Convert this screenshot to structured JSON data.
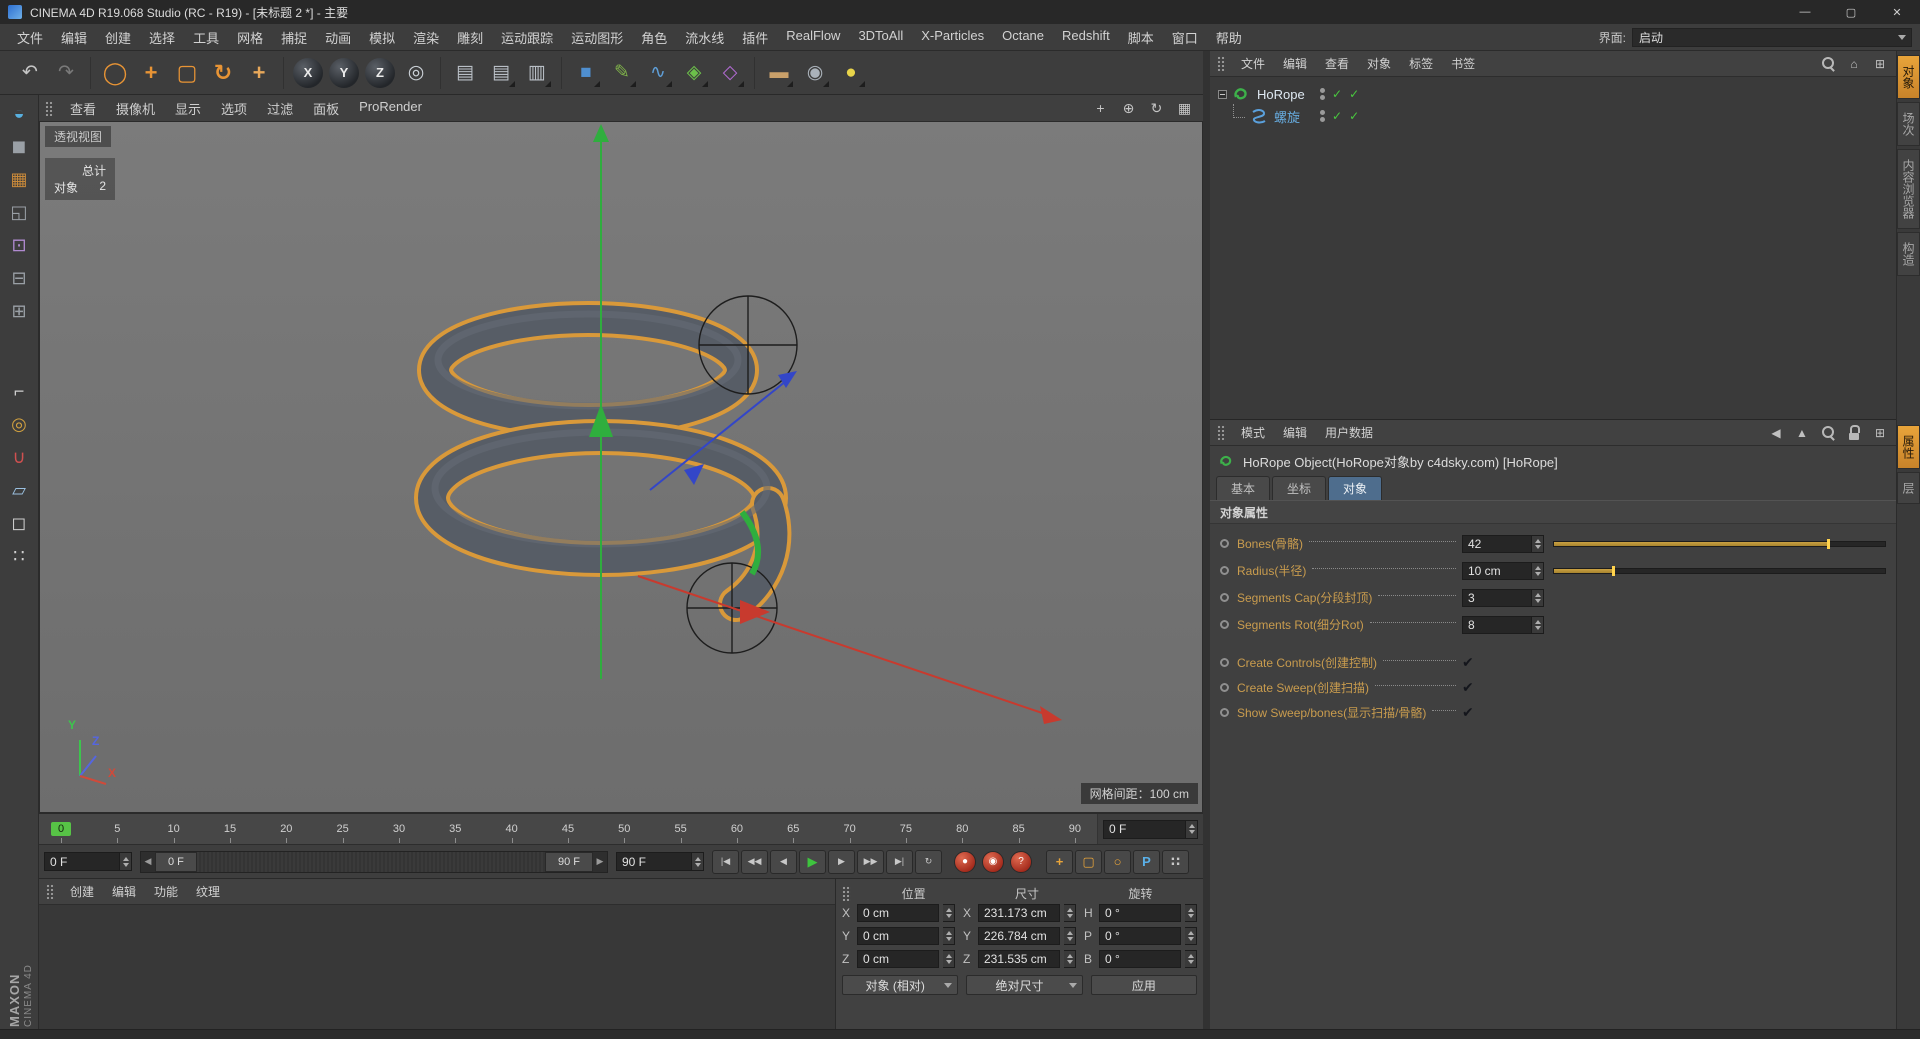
{
  "window": {
    "title": "CINEMA 4D R19.068 Studio (RC - R19) - [未标题 2 *] - 主要",
    "buttons": [
      {
        "name": "minimize-button",
        "glyph": "—"
      },
      {
        "name": "maximize-button",
        "glyph": "▢"
      },
      {
        "name": "close-button",
        "glyph": "✕"
      }
    ]
  },
  "menu_bar": {
    "items": [
      "文件",
      "编辑",
      "创建",
      "选择",
      "工具",
      "网格",
      "捕捉",
      "动画",
      "模拟",
      "渲染",
      "雕刻",
      "运动跟踪",
      "运动图形",
      "角色",
      "流水线",
      "插件",
      "RealFlow",
      "3DToAll",
      "X-Particles",
      "Octane",
      "Redshift",
      "脚本",
      "窗口",
      "帮助"
    ],
    "interface_label": "界面:",
    "interface_value": "启动"
  },
  "toolbar": {
    "history": [
      {
        "name": "undo-icon",
        "glyph": "↶",
        "fg": "#c6c6c6"
      },
      {
        "name": "redo-icon",
        "glyph": "↷",
        "fg": "#7a7a7a"
      }
    ],
    "tools": [
      {
        "name": "live-selection-icon",
        "glyph": "◯",
        "fg": "#e89435",
        "cls": "big"
      },
      {
        "name": "move-tool-icon",
        "glyph": "+",
        "fg": "#e89435",
        "cls": "big"
      },
      {
        "name": "scale-tool-icon",
        "glyph": "▢",
        "fg": "#e89435",
        "cls": "big"
      },
      {
        "name": "rotate-tool-icon",
        "glyph": "↻",
        "fg": "#e89435",
        "cls": "big"
      },
      {
        "name": "last-tool-icon",
        "glyph": "+",
        "fg": "#e8a85a",
        "cls": "big"
      }
    ],
    "axis": [
      {
        "name": "x-axis-lock-icon",
        "glyph": "X",
        "cls": "ball"
      },
      {
        "name": "y-axis-lock-icon",
        "glyph": "Y",
        "cls": "ball"
      },
      {
        "name": "z-axis-lock-icon",
        "glyph": "Z",
        "cls": "ball"
      },
      {
        "name": "coordinate-system-icon",
        "glyph": "◎",
        "fg": "#ccd2d8"
      }
    ],
    "render": [
      {
        "name": "render-view-icon",
        "glyph": "▤",
        "fg": "#b9bfc6"
      },
      {
        "name": "render-picture-viewer-icon",
        "glyph": "▤",
        "fg": "#b9bfc6",
        "cls": "corner"
      },
      {
        "name": "render-settings-icon",
        "glyph": "▥",
        "fg": "#b9bfc6",
        "cls": "corner"
      }
    ],
    "create": [
      {
        "name": "cube-primitive-icon",
        "glyph": "■",
        "fg": "#4f8fd0",
        "cls": "corner"
      },
      {
        "name": "spline-pen-icon",
        "glyph": "✎",
        "fg": "#7fb24a",
        "cls": "corner"
      },
      {
        "name": "spline-primitives-icon",
        "glyph": "∿",
        "fg": "#5f9fd8",
        "cls": "corner"
      },
      {
        "name": "mograph-icon",
        "glyph": "◈",
        "fg": "#6cc04a",
        "cls": "corner"
      },
      {
        "name": "deformer-icon",
        "glyph": "◇",
        "fg": "#b06ad0",
        "cls": "corner"
      }
    ],
    "scene": [
      {
        "name": "environment-floor-icon",
        "glyph": "▬",
        "fg": "#c9a06a",
        "cls": "corner"
      },
      {
        "name": "camera-icon",
        "glyph": "◉",
        "fg": "#aab2ba",
        "cls": "corner"
      },
      {
        "name": "light-icon",
        "glyph": "●",
        "fg": "#e8d44a",
        "cls": "corner"
      }
    ]
  },
  "left_toolbar": {
    "icons": [
      {
        "name": "convert-editable-icon",
        "glyph": "◒",
        "fg": "#58b0e0"
      },
      {
        "name": "model-mode-icon",
        "glyph": "◼",
        "fg": "#9aa0a6"
      },
      {
        "name": "texture-mode-icon",
        "glyph": "▦",
        "fg": "#c8893a"
      },
      {
        "name": "workplane-mode-icon",
        "glyph": "◱",
        "fg": "#9aa0a6"
      },
      {
        "name": "point-mode-icon",
        "glyph": "⊡",
        "fg": "#b08ad0"
      },
      {
        "name": "edge-mode-icon",
        "glyph": "⊟",
        "fg": "#9aa0a6"
      },
      {
        "name": "polygon-mode-icon",
        "glyph": "⊞",
        "fg": "#9aa0a6"
      },
      {
        "name": "enable-axis-icon",
        "glyph": "⌐",
        "fg": "#d0d0d0",
        "cls": "gap"
      },
      {
        "name": "viewport-solo-icon",
        "glyph": "◎",
        "fg": "#d0a040"
      },
      {
        "name": "snap-icon",
        "glyph": "∪",
        "fg": "#d05050"
      },
      {
        "name": "workplane-icon",
        "glyph": "▱",
        "fg": "#9ac0e0"
      },
      {
        "name": "lock-workplane-icon",
        "glyph": "◻",
        "fg": "#d0d0d0"
      },
      {
        "name": "quantize-icon",
        "glyph": "∷",
        "fg": "#d0d0d0"
      }
    ]
  },
  "viewport": {
    "menu_items": [
      "查看",
      "摄像机",
      "显示",
      "选项",
      "过滤",
      "面板",
      "ProRender"
    ],
    "nav_icons": [
      {
        "name": "pan-view-icon",
        "glyph": "+"
      },
      {
        "name": "zoom-view-icon",
        "glyph": "⊕"
      },
      {
        "name": "rotate-view-icon",
        "glyph": "↻"
      },
      {
        "name": "toggle-views-icon",
        "glyph": "▦"
      }
    ],
    "view_label": "透视视图",
    "hud": {
      "total_label": "总计",
      "objects_label": "对象",
      "objects_count": "2"
    },
    "grid_label": "网格间距：100 cm",
    "axis": {
      "x": "X",
      "y": "Y",
      "z": "Z"
    }
  },
  "timeline": {
    "ticks": [
      {
        "t": "0",
        "cls": "cur"
      },
      {
        "t": "5"
      },
      {
        "t": "10"
      },
      {
        "t": "15"
      },
      {
        "t": "20"
      },
      {
        "t": "25"
      },
      {
        "t": "30"
      },
      {
        "t": "35"
      },
      {
        "t": "40"
      },
      {
        "t": "45"
      },
      {
        "t": "50"
      },
      {
        "t": "55"
      },
      {
        "t": "60"
      },
      {
        "t": "65"
      },
      {
        "t": "70"
      },
      {
        "t": "75"
      },
      {
        "t": "80"
      },
      {
        "t": "85"
      },
      {
        "t": "90"
      }
    ],
    "frame_spinner": "0 F"
  },
  "transport": {
    "current_frame": "0 F",
    "range_start": "0 F",
    "range_end": "90 F",
    "range_left_glyph": "◀",
    "range_right_glyph": "▶",
    "end_frame": "90 F",
    "buttons": [
      {
        "name": "goto-start-button",
        "glyph": "|◀"
      },
      {
        "name": "prev-key-button",
        "glyph": "◀◀"
      },
      {
        "name": "prev-frame-button",
        "glyph": "◀"
      },
      {
        "name": "play-button",
        "glyph": "▶",
        "cls": "play"
      },
      {
        "name": "next-frame-button",
        "glyph": "▶"
      },
      {
        "name": "next-key-button",
        "glyph": "▶▶"
      },
      {
        "name": "goto-end-button",
        "glyph": "▶|"
      },
      {
        "name": "loop-button",
        "glyph": "↻"
      }
    ],
    "record_buttons": [
      {
        "name": "record-keyframe-button",
        "glyph": "●"
      },
      {
        "name": "autokey-button",
        "glyph": "◉"
      },
      {
        "name": "record-options-button",
        "glyph": "?"
      }
    ],
    "key_buttons": [
      {
        "name": "position-key-icon",
        "glyph": "+",
        "fg": "#e8a43a"
      },
      {
        "name": "scale-key-icon",
        "glyph": "▢",
        "fg": "#e8a43a"
      },
      {
        "name": "rotation-key-icon",
        "glyph": "○",
        "fg": "#e8a43a"
      },
      {
        "name": "parameter-key-icon",
        "glyph": "P",
        "fg": "#5ab0e8"
      },
      {
        "name": "pla-key-icon",
        "glyph": "∷",
        "fg": "#c8c8c8"
      }
    ],
    "solo_button": {
      "glyph": "▦"
    }
  },
  "coordinates": {
    "position": {
      "title": "位置",
      "rows": [
        {
          "label": "X",
          "value": "0 cm"
        },
        {
          "label": "Y",
          "value": "0 cm"
        },
        {
          "label": "Z",
          "value": "0 cm"
        }
      ]
    },
    "size": {
      "title": "尺寸",
      "rows": [
        {
          "label": "X",
          "value": "231.173 cm"
        },
        {
          "label": "Y",
          "value": "226.784 cm"
        },
        {
          "label": "Z",
          "value": "231.535 cm"
        }
      ]
    },
    "rotation": {
      "title": "旋转",
      "rows": [
        {
          "label": "H",
          "value": "0 °"
        },
        {
          "label": "P",
          "value": "0 °"
        },
        {
          "label": "B",
          "value": "0 °"
        }
      ]
    },
    "mode_dropdown": "对象 (相对)",
    "size_mode_dropdown": "绝对尺寸",
    "apply_button": "应用"
  },
  "material_manager": {
    "menu_items": [
      "创建",
      "编辑",
      "功能",
      "纹理"
    ]
  },
  "brand": {
    "line1": "MAXON",
    "line2": "CINEMA 4D"
  },
  "object_manager": {
    "menu_items": [
      "文件",
      "编辑",
      "查看",
      "对象",
      "标签",
      "书签"
    ],
    "right_icons": [
      {
        "name": "search-icon",
        "glyph": "",
        "cls": "mag"
      },
      {
        "name": "browser-icon",
        "glyph": "⌂"
      },
      {
        "name": "panel-menu-icon",
        "glyph": "⊞"
      }
    ],
    "check_glyph": "✓",
    "tree": [
      {
        "label": "HoRope"
      },
      {
        "label": "螺旋"
      }
    ]
  },
  "attribute_manager": {
    "menu_items": [
      "模式",
      "编辑",
      "用户数据"
    ],
    "right_icons": [
      {
        "name": "back-arrow-icon",
        "glyph": "◀"
      },
      {
        "name": "pin-icon",
        "glyph": "▲"
      },
      {
        "name": "search-icon",
        "glyph": "",
        "cls": "mag"
      },
      {
        "name": "lock-icon",
        "glyph": "",
        "cls": "lockicon"
      },
      {
        "name": "add-panel-icon",
        "glyph": "⊞"
      }
    ],
    "object_title": "HoRope Object(HoRope对象by c4dsky.com) [HoRope]",
    "tabs": [
      {
        "label": "基本"
      },
      {
        "label": "坐标"
      },
      {
        "label": "对象",
        "cls": "active"
      }
    ],
    "section_title": "对象属性",
    "check_glyph": "✔",
    "params": [
      {
        "label": "Bones(骨骼)",
        "value": "42",
        "slider": "sl-yes",
        "slider_pct": "83%"
      },
      {
        "label": "Radius(半径)",
        "value": "10 cm",
        "slider": "sl-yes",
        "slider_pct": "18%"
      },
      {
        "label": "Segments Cap(分段封顶)",
        "value": "3",
        "slider": "sl-no",
        "slider_pct": "0%"
      },
      {
        "label": "Segments Rot(细分Rot)",
        "value": "8",
        "slider": "sl-no",
        "slider_pct": "0%"
      }
    ],
    "checks": [
      {
        "label": "Create Controls(创建控制)"
      },
      {
        "label": "Create Sweep(创建扫描)"
      },
      {
        "label": "Show Sweep/bones(显示扫描/骨骼)"
      }
    ]
  },
  "right_tabs": {
    "top": [
      {
        "label": "对象",
        "cls": "active"
      },
      {
        "label": "场次"
      },
      {
        "label": "内容浏览器"
      },
      {
        "label": "构造"
      }
    ],
    "bottom": [
      {
        "label": "属性",
        "cls": "active"
      },
      {
        "label": "层"
      }
    ]
  },
  "colors": {
    "accent_orange": "#e8932c",
    "selection_outline": "#d9993a",
    "axis_x": "#c83a2e",
    "axis_y": "#2fae3e",
    "axis_z": "#3346c8",
    "play_green": "#3ec43e",
    "record_red": "#c8402e",
    "active_tab_blue": "#4e6d8d",
    "param_label": "#c99c4e",
    "helix_label": "#66aadd"
  }
}
